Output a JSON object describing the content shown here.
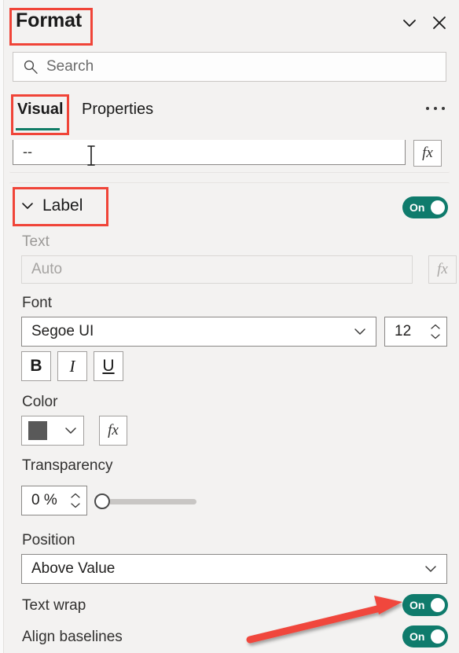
{
  "header": {
    "title": "Format",
    "collapse_icon": "chevron-down-icon",
    "close_icon": "close-icon"
  },
  "search": {
    "placeholder": "Search",
    "icon": "search-icon"
  },
  "tabs": {
    "visual": "Visual",
    "properties": "Properties",
    "active": "Visual",
    "more_icon": "ellipsis-icon",
    "accent_color": "#107c66"
  },
  "top_field": {
    "value": "--",
    "fx_label": "fx"
  },
  "label_section": {
    "title": "Label",
    "expander_icon": "chevron-down-icon",
    "toggle": "On",
    "text": {
      "label": "Text",
      "placeholder": "Auto",
      "fx_label": "fx",
      "disabled": true
    },
    "font": {
      "label": "Font",
      "family": "Segoe UI",
      "size": "12",
      "bold": "B",
      "italic": "I",
      "underline": "U"
    },
    "color": {
      "label": "Color",
      "value": "#595959",
      "fx_label": "fx"
    },
    "transparency": {
      "label": "Transparency",
      "value": "0 %",
      "slider_percent": 0
    },
    "position": {
      "label": "Position",
      "value": "Above Value"
    },
    "text_wrap": {
      "label": "Text wrap",
      "toggle": "On"
    },
    "align_baselines": {
      "label": "Align baselines",
      "toggle": "On"
    }
  },
  "annotations": {
    "box_color": "#f04438",
    "arrow_color": "#f0473c",
    "boxes": [
      "Format",
      "Visual",
      "Label"
    ],
    "arrow_points_to": "Text wrap"
  },
  "colors": {
    "panel_bg": "#f3f2f1",
    "toggle_on": "#0f7b6c",
    "text": "#1a1a1a"
  }
}
